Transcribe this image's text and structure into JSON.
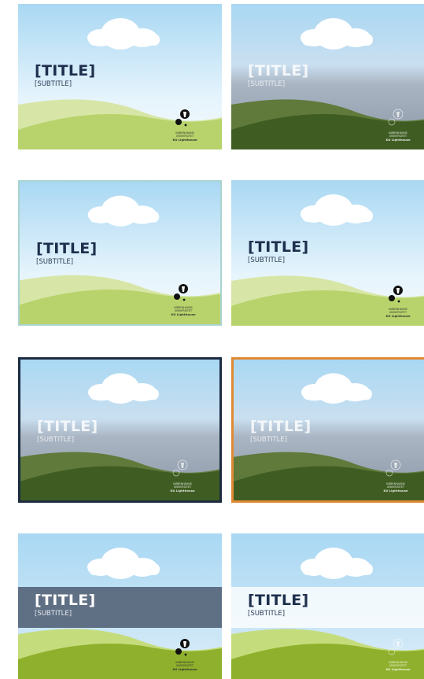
{
  "template": {
    "title": "[TITLE]",
    "subtitle": "[SUBTITLE]",
    "logo_line1": "KØBENHAVNS",
    "logo_line2": "UNIVERSITET",
    "logo_brand": "KU Lighthouse"
  },
  "colors": {
    "sky_top": "#a9d8f3",
    "sky_bottom": "#eef7fd",
    "grass_light": "#c7dc8a",
    "grass_mid": "#a6c44f",
    "grass_dark": "#3f5d22",
    "title_dark": "#1e2f4d",
    "border_teal": "#a9d4cf",
    "border_navy": "#1c2c40",
    "border_orange": "#e08a34",
    "band_slate": "#5f6f84"
  },
  "thumbnails": [
    {
      "name": "thumb-1",
      "variant": "light-sky",
      "border": "none"
    },
    {
      "name": "thumb-2",
      "variant": "grey-overlay",
      "border": "none"
    },
    {
      "name": "thumb-3",
      "variant": "light-sky",
      "border": "teal"
    },
    {
      "name": "thumb-4",
      "variant": "light-sky",
      "border": "none"
    },
    {
      "name": "thumb-5",
      "variant": "grey-overlay",
      "border": "navy"
    },
    {
      "name": "thumb-6",
      "variant": "grey-overlay",
      "border": "orange"
    },
    {
      "name": "thumb-7",
      "variant": "slate-title-band",
      "border": "none"
    },
    {
      "name": "thumb-8",
      "variant": "white-title-band",
      "border": "none"
    }
  ]
}
